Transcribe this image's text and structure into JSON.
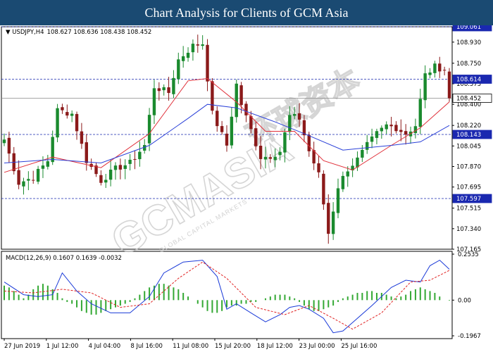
{
  "page": {
    "title": "Chart Analysis for Clients of GCM Asia"
  },
  "watermark": {
    "main": "GCMASIA",
    "sub": "GLOBAL CAPITAL MARKETS",
    "cn": "环球资本"
  },
  "colors": {
    "title_bg": "#1a4a72",
    "bull": "#1a8a2e",
    "bear": "#8b1a1a",
    "ma_fast": "#e0303a",
    "ma_slow": "#2a40d8",
    "level_line": "#1a28b0",
    "macd_hist": "#33a833",
    "macd_line": "#1a3ad8",
    "macd_signal": "#e02020"
  },
  "chart_data": [
    {
      "type": "candlestick",
      "symbol": "USDJPY,H4",
      "ohlc_readout": "108.627 108.636 108.438 108.452",
      "ylim": [
        107.165,
        109.061
      ],
      "yticks": [
        "109.061",
        "108.930",
        "108.750",
        "108.575",
        "108.400",
        "108.220",
        "108.045",
        "107.870",
        "107.695",
        "107.515",
        "107.340",
        "107.165"
      ],
      "xticks": [
        "27 Jun 2019",
        "1 Jul 12:00",
        "4 Jul 04:00",
        "8 Jul 16:00",
        "11 Jul 08:00",
        "15 Jul 20:00",
        "18 Jul 12:00",
        "23 Jul 00:00",
        "25 Jul 16:00"
      ],
      "levels": [
        {
          "value": 109.061,
          "label": "109.061",
          "style": "dashed",
          "tag_bg": "#1a28b0"
        },
        {
          "value": 108.614,
          "label": "108.614",
          "style": "dashed",
          "tag_bg": "#1a28b0"
        },
        {
          "value": 108.452,
          "label": "108.452",
          "style": "solid",
          "tag_bg": "#ffffff"
        },
        {
          "value": 108.143,
          "label": "108.143",
          "style": "dashed",
          "tag_bg": "#1a28b0"
        },
        {
          "value": 107.597,
          "label": "107.597",
          "style": "dashed",
          "tag_bg": "#1a28b0"
        }
      ],
      "anchors": [
        [
          0,
          108.1
        ],
        [
          3,
          107.73
        ],
        [
          6,
          107.78
        ],
        [
          9,
          107.92
        ],
        [
          11,
          108.35
        ],
        [
          14,
          108.32
        ],
        [
          17,
          107.92
        ],
        [
          20,
          107.75
        ],
        [
          23,
          107.85
        ],
        [
          26,
          107.9
        ],
        [
          29,
          108.05
        ],
        [
          31,
          108.55
        ],
        [
          34,
          108.5
        ],
        [
          36,
          108.78
        ],
        [
          39,
          108.9
        ],
        [
          41,
          108.92
        ],
        [
          43,
          108.32
        ],
        [
          44,
          108.23
        ],
        [
          46,
          108.05
        ],
        [
          48,
          108.57
        ],
        [
          49,
          108.4
        ],
        [
          51,
          108.18
        ],
        [
          53,
          107.95
        ],
        [
          55,
          107.96
        ],
        [
          57,
          108.0
        ],
        [
          59,
          108.3
        ],
        [
          61,
          108.28
        ],
        [
          63,
          108.0
        ],
        [
          65,
          107.8
        ],
        [
          67,
          107.3
        ],
        [
          69,
          107.7
        ],
        [
          71,
          107.85
        ],
        [
          73,
          107.93
        ],
        [
          75,
          108.05
        ],
        [
          77,
          108.15
        ],
        [
          79,
          108.22
        ],
        [
          81,
          108.2
        ],
        [
          83,
          108.15
        ],
        [
          85,
          108.22
        ],
        [
          87,
          108.65
        ],
        [
          89,
          108.72
        ],
        [
          91,
          108.7
        ],
        [
          92,
          108.452
        ]
      ],
      "ma_fast": [
        [
          0,
          107.82
        ],
        [
          10,
          107.95
        ],
        [
          20,
          107.86
        ],
        [
          30,
          108.15
        ],
        [
          38,
          108.6
        ],
        [
          42,
          108.62
        ],
        [
          48,
          108.42
        ],
        [
          54,
          108.17
        ],
        [
          60,
          108.17
        ],
        [
          66,
          107.92
        ],
        [
          72,
          107.84
        ],
        [
          80,
          108.05
        ],
        [
          86,
          108.2
        ],
        [
          92,
          108.42
        ]
      ],
      "ma_slow": [
        [
          0,
          107.9
        ],
        [
          10,
          107.93
        ],
        [
          20,
          107.9
        ],
        [
          30,
          108.05
        ],
        [
          38,
          108.28
        ],
        [
          42,
          108.4
        ],
        [
          48,
          108.37
        ],
        [
          56,
          108.25
        ],
        [
          62,
          108.15
        ],
        [
          70,
          108.01
        ],
        [
          80,
          108.05
        ],
        [
          86,
          108.08
        ],
        [
          92,
          108.22
        ]
      ]
    },
    {
      "type": "macd",
      "label": "MACD(12,26,9) 0.1607 0.1639 -0.0032",
      "ylim": [
        -0.1967,
        0.2535
      ],
      "yticks": [
        "0.2535",
        "0.00",
        "-0.1967"
      ],
      "histogram": [
        0.08,
        0.07,
        0.05,
        0.03,
        0.01,
        0.03,
        0.06,
        0.08,
        0.09,
        0.08,
        0.06,
        0.04,
        0.01,
        -0.01,
        -0.02,
        -0.04,
        -0.06,
        -0.07,
        -0.08,
        -0.08,
        -0.07,
        -0.06,
        -0.05,
        -0.04,
        -0.03,
        -0.02,
        -0.01,
        0.01,
        0.03,
        0.05,
        0.07,
        0.08,
        0.09,
        0.09,
        0.08,
        0.07,
        0.06,
        0.04,
        0.02,
        0.0,
        -0.02,
        -0.04,
        -0.06,
        -0.07,
        -0.07,
        -0.06,
        -0.04,
        -0.03,
        -0.03,
        -0.02,
        -0.02,
        -0.01,
        -0.01,
        0.0,
        0.01,
        0.02,
        0.03,
        0.03,
        0.03,
        0.02,
        0.01,
        -0.01,
        -0.03,
        -0.05,
        -0.06,
        -0.06,
        -0.05,
        -0.04,
        -0.03,
        -0.01,
        0.01,
        0.02,
        0.03,
        0.04,
        0.04,
        0.05,
        0.05,
        0.04,
        0.04,
        0.03,
        0.02,
        0.01,
        0.02,
        0.03,
        0.05,
        0.06,
        0.07,
        0.06,
        0.05,
        0.04,
        0.02,
        0.0,
        -0.003
      ],
      "macd_line": [
        [
          0,
          0.1
        ],
        [
          4,
          0.03
        ],
        [
          7,
          0.02
        ],
        [
          10,
          0.03
        ],
        [
          12,
          0.15
        ],
        [
          15,
          0.05
        ],
        [
          18,
          -0.02
        ],
        [
          22,
          -0.07
        ],
        [
          26,
          -0.07
        ],
        [
          30,
          0.02
        ],
        [
          33,
          0.15
        ],
        [
          37,
          0.21
        ],
        [
          41,
          0.22
        ],
        [
          44,
          0.13
        ],
        [
          46,
          -0.05
        ],
        [
          48,
          -0.02
        ],
        [
          51,
          -0.07
        ],
        [
          54,
          -0.12
        ],
        [
          57,
          -0.08
        ],
        [
          59,
          -0.04
        ],
        [
          61,
          -0.03
        ],
        [
          63,
          -0.05
        ],
        [
          66,
          -0.1
        ],
        [
          68,
          -0.18
        ],
        [
          70,
          -0.17
        ],
        [
          73,
          -0.1
        ],
        [
          76,
          -0.03
        ],
        [
          80,
          0.07
        ],
        [
          83,
          0.11
        ],
        [
          86,
          0.1
        ],
        [
          88,
          0.19
        ],
        [
          90,
          0.22
        ],
        [
          92,
          0.17
        ]
      ],
      "signal_line": [
        [
          0,
          0.05
        ],
        [
          6,
          0.04
        ],
        [
          12,
          0.06
        ],
        [
          18,
          0.04
        ],
        [
          24,
          -0.04
        ],
        [
          30,
          -0.02
        ],
        [
          36,
          0.12
        ],
        [
          41,
          0.21
        ],
        [
          46,
          0.12
        ],
        [
          52,
          -0.04
        ],
        [
          58,
          -0.08
        ],
        [
          63,
          -0.03
        ],
        [
          68,
          -0.1
        ],
        [
          72,
          -0.16
        ],
        [
          78,
          -0.07
        ],
        [
          84,
          0.1
        ],
        [
          88,
          0.11
        ],
        [
          92,
          0.164
        ]
      ]
    }
  ]
}
